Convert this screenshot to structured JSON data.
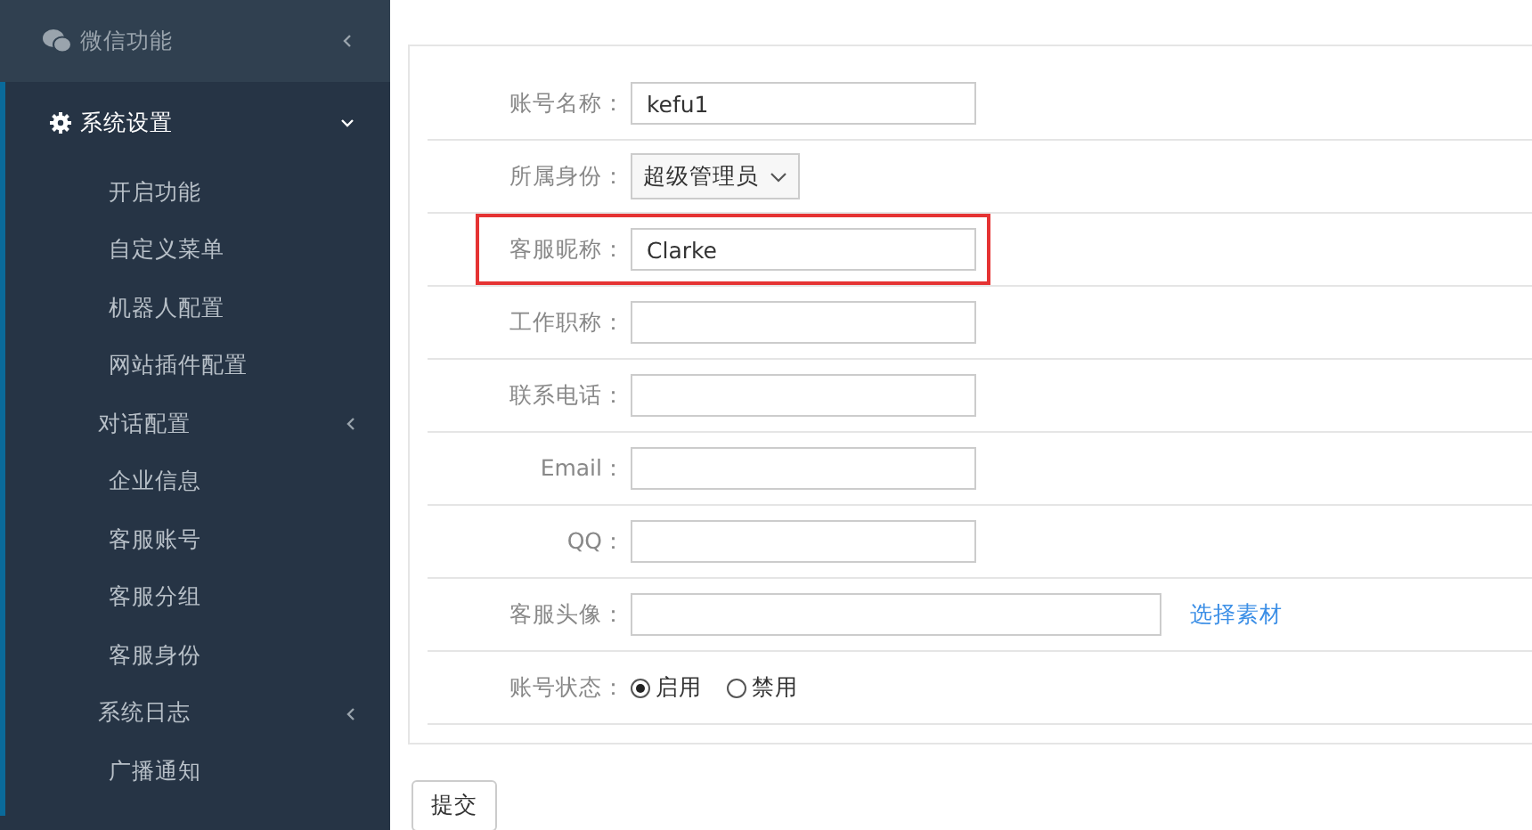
{
  "sidebar": {
    "items": [
      {
        "label": "微信功能",
        "expanded": false
      },
      {
        "label": "系统设置",
        "expanded": true,
        "children": [
          {
            "label": "开启功能"
          },
          {
            "label": "自定义菜单"
          },
          {
            "label": "机器人配置"
          },
          {
            "label": "网站插件配置"
          },
          {
            "label": "对话配置",
            "children": [
              {
                "label": "企业信息"
              },
              {
                "label": "客服账号"
              },
              {
                "label": "客服分组"
              },
              {
                "label": "客服身份"
              }
            ]
          },
          {
            "label": "系统日志",
            "children": [
              {
                "label": "广播通知"
              }
            ]
          }
        ]
      }
    ]
  },
  "form": {
    "fields": [
      {
        "label": "账号名称：",
        "kind": "text",
        "value": "kefu1",
        "highlighted": false
      },
      {
        "label": "所属身份：",
        "kind": "select",
        "value": "超级管理员",
        "highlighted": false
      },
      {
        "label": "客服昵称：",
        "kind": "text",
        "value": "Clarke",
        "highlighted": true
      },
      {
        "label": "工作职称：",
        "kind": "text",
        "highlighted": false
      },
      {
        "label": "联系电话：",
        "kind": "text",
        "highlighted": false
      },
      {
        "label": "Email：",
        "kind": "text",
        "highlighted": false
      },
      {
        "label": "QQ：",
        "kind": "text",
        "highlighted": false
      },
      {
        "label": "客服头像：",
        "kind": "wide",
        "link": "选择素材",
        "highlighted": false
      },
      {
        "label": "账号状态：",
        "kind": "radio",
        "highlighted": false,
        "options": [
          {
            "label": "启用",
            "selected": true
          },
          {
            "label": "禁用",
            "selected": false
          }
        ]
      }
    ],
    "submit": "提交"
  }
}
